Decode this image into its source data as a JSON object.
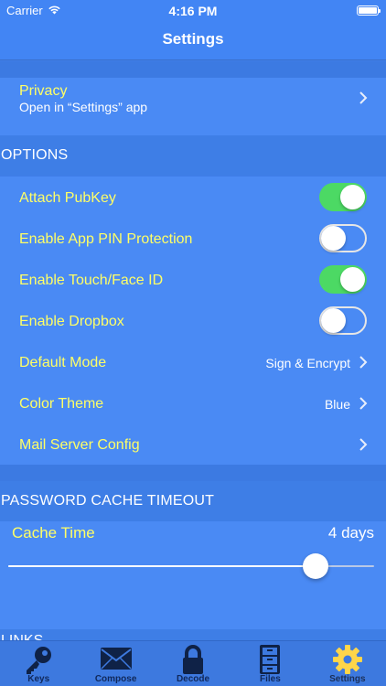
{
  "status": {
    "carrier": "Carrier",
    "time": "4:16 PM",
    "wifi_icon": "wifi-icon",
    "battery_icon": "battery-icon"
  },
  "nav": {
    "title": "Settings"
  },
  "privacy": {
    "label": "Privacy",
    "sublabel": "Open in “Settings” app"
  },
  "options": {
    "header": "OPTIONS",
    "rows": [
      {
        "label": "Attach PubKey",
        "type": "toggle",
        "on": true
      },
      {
        "label": "Enable App PIN Protection",
        "type": "toggle",
        "on": false
      },
      {
        "label": "Enable Touch/Face ID",
        "type": "toggle",
        "on": true
      },
      {
        "label": "Enable Dropbox",
        "type": "toggle",
        "on": false
      },
      {
        "label": "Default Mode",
        "type": "disclosure",
        "value": "Sign & Encrypt"
      },
      {
        "label": "Color Theme",
        "type": "disclosure",
        "value": "Blue"
      },
      {
        "label": "Mail Server Config",
        "type": "disclosure",
        "value": ""
      }
    ]
  },
  "password_cache": {
    "header": "PASSWORD CACHE TIMEOUT",
    "label": "Cache Time",
    "value": "4 days",
    "slider_fraction": 0.84
  },
  "next_section_peek": "LINKS",
  "tabs": [
    {
      "label": "Keys",
      "icon": "key-icon",
      "active": false
    },
    {
      "label": "Compose",
      "icon": "envelope-icon",
      "active": false
    },
    {
      "label": "Decode",
      "icon": "lock-icon",
      "active": false
    },
    {
      "label": "Files",
      "icon": "file-cabinet-icon",
      "active": false
    },
    {
      "label": "Settings",
      "icon": "gear-icon",
      "active": true
    }
  ],
  "colors": {
    "background": "#3f7ee8",
    "row": "#4a8af4",
    "label_yellow": "#ffff66",
    "toggle_on": "#4cd964",
    "active_tab_icon": "#ffd54a"
  }
}
